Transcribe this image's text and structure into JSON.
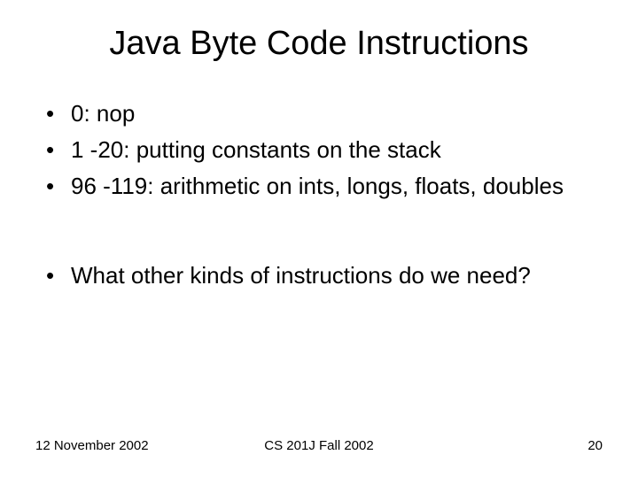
{
  "title": "Java Byte Code Instructions",
  "bullets": [
    "0: nop",
    "1 -20: putting constants on the stack",
    "96 -119: arithmetic on ints, longs, floats, doubles"
  ],
  "question": "What other kinds of instructions do we need?",
  "footer": {
    "date": "12 November 2002",
    "course": "CS 201J Fall 2002",
    "page": "20"
  }
}
